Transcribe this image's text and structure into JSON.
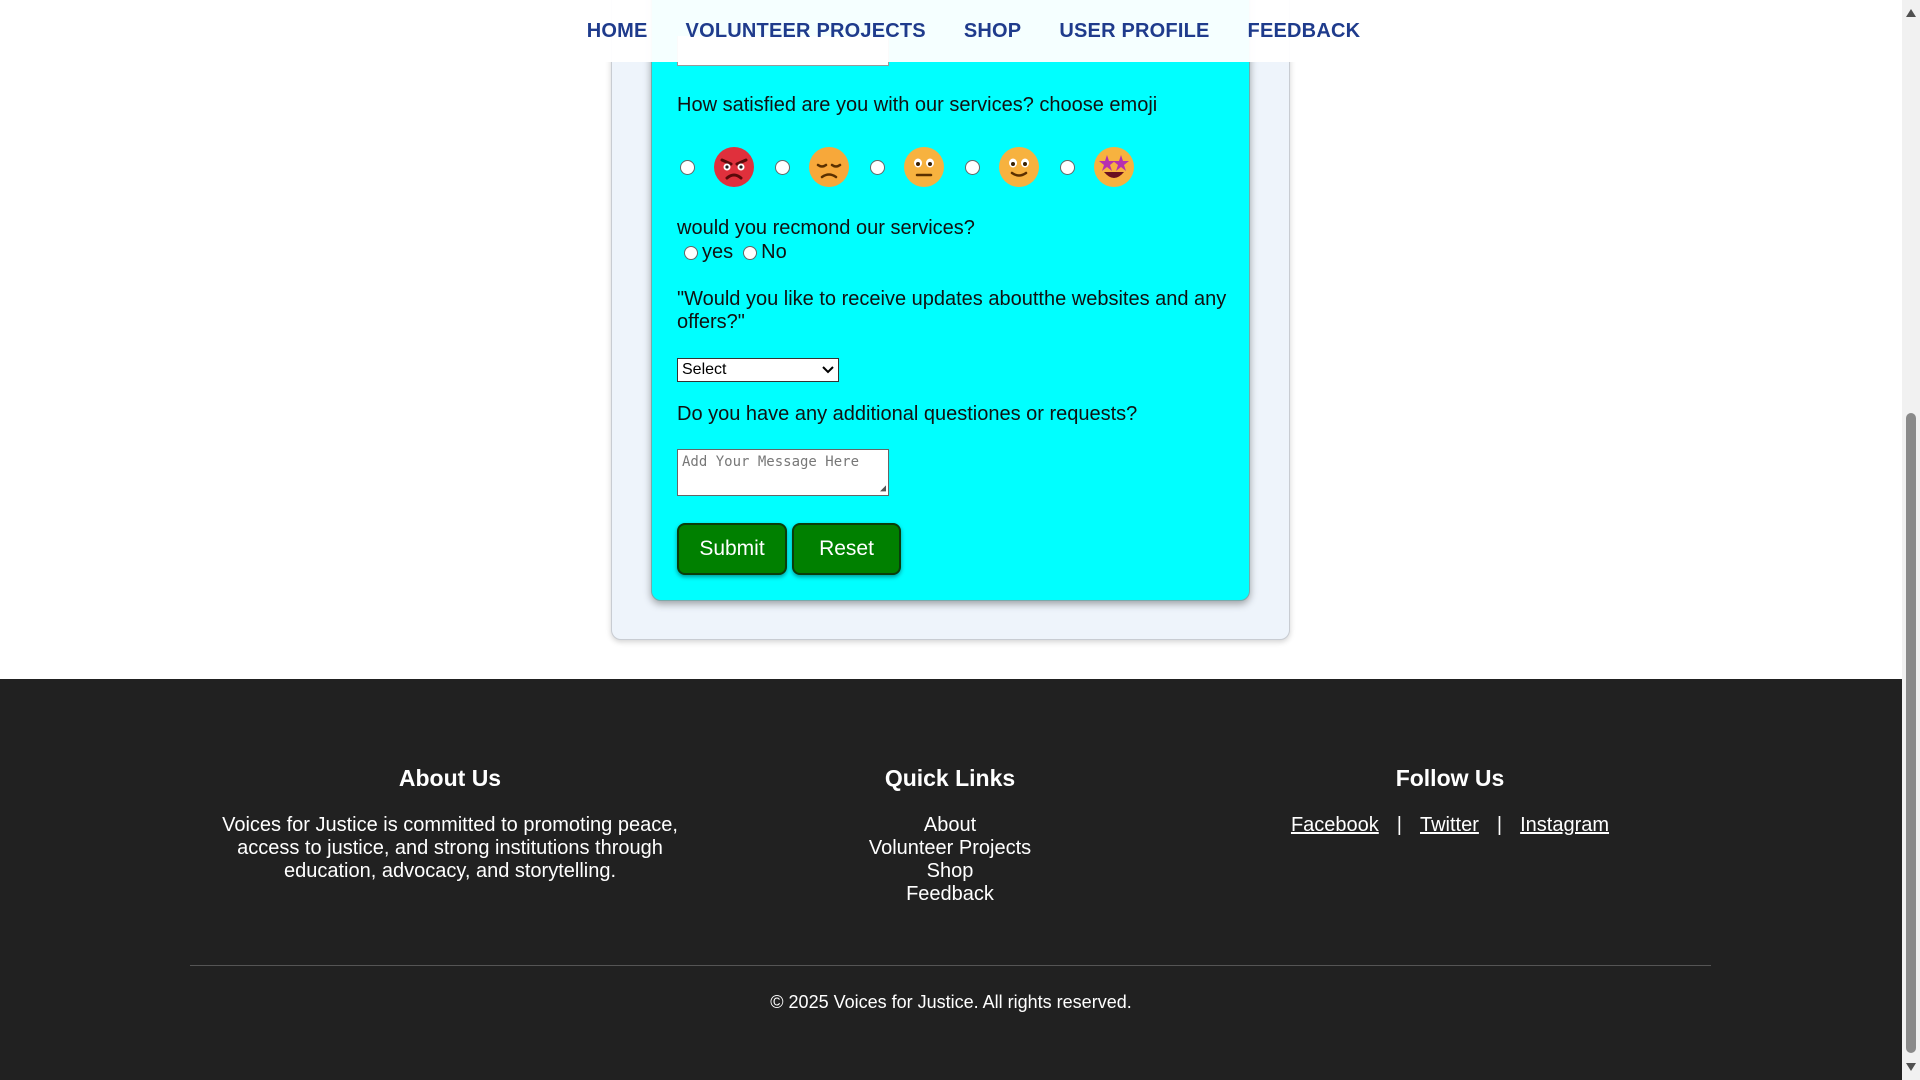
{
  "nav": {
    "items": [
      "HOME",
      "VOLUNTEER PROJECTS",
      "SHOP",
      "USER PROFILE",
      "FEEDBACK"
    ]
  },
  "form": {
    "satisfaction_question": "How satisfied are you with our services? choose emoji",
    "emojis": [
      "angry-face-icon",
      "disappointed-face-icon",
      "neutral-face-icon",
      "smiling-face-icon",
      "star-struck-face-icon"
    ],
    "recommend_question": "would you recmond our services?",
    "recommend_options": [
      "yes",
      "No"
    ],
    "updates_question": "\"Would you like to receive updates aboutthe websites and any offers?\"",
    "updates_select_value": "Select",
    "additional_question": "Do you have any additional questiones or requests?",
    "message_placeholder": "Add Your Message Here",
    "submit_label": "Submit",
    "reset_label": "Reset"
  },
  "footer": {
    "about_heading": "About Us",
    "about_text": "Voices for Justice is committed to promoting peace, access to justice, and strong institutions through education, advocacy, and storytelling.",
    "links_heading": "Quick Links",
    "links": [
      "About",
      "Volunteer Projects",
      "Shop",
      "Feedback"
    ],
    "follow_heading": "Follow Us",
    "social": [
      "Facebook",
      "Twitter",
      "Instagram"
    ],
    "separator": "|",
    "copyright": "© 2025 Voices for Justice. All rights reserved."
  },
  "colors": {
    "nav_text": "#1f3b8c",
    "form_bg": "#00ffff",
    "button_bg": "#008000",
    "footer_bg": "#212121"
  }
}
